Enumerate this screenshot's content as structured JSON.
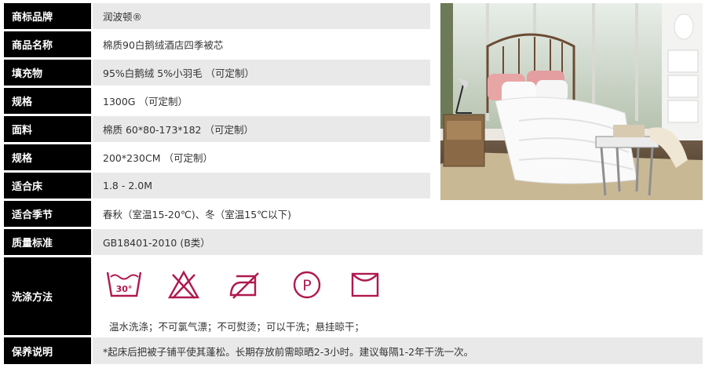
{
  "rows": [
    {
      "label": "商标品牌",
      "value": "润波顿®"
    },
    {
      "label": "商品名称",
      "value": "棉质90白鹅绒酒店四季被芯"
    },
    {
      "label": "填充物",
      "value": "95%白鹅绒   5%小羽毛 （可定制）"
    },
    {
      "label": "规格",
      "value": "1300G （可定制）"
    },
    {
      "label": "面料",
      "value": "棉质   60*80-173*182 （可定制）"
    },
    {
      "label": "规格",
      "value": "200*230CM （可定制）"
    },
    {
      "label": "适合床",
      "value": "1.8 - 2.0M"
    },
    {
      "label": "适合季节",
      "value": "春秋（室温15-20℃)、冬（室温15℃以下)"
    },
    {
      "label": "质量标准",
      "value": "GB18401-2010 (B类）"
    }
  ],
  "washing": {
    "label": "洗涤方法",
    "icons": [
      "wash-30-icon",
      "no-bleach-icon",
      "no-iron-icon",
      "dry-clean-p-icon",
      "hang-dry-icon"
    ],
    "temp_label": "30°",
    "dryclean_letter": "P",
    "text": "温水洗涤；不可氯气漂；不可熨烫；可以干洗；悬挂晾干；"
  },
  "care": {
    "label": "保养说明",
    "value": "*起床后把被子铺平使其蓬松。长期存放前需晾晒2-3小时。建议每隔1-2年干洗一次。"
  },
  "colors": {
    "label_bg": "#000000",
    "row_gray": "#e9e9e9",
    "icon": "#b0184f"
  }
}
